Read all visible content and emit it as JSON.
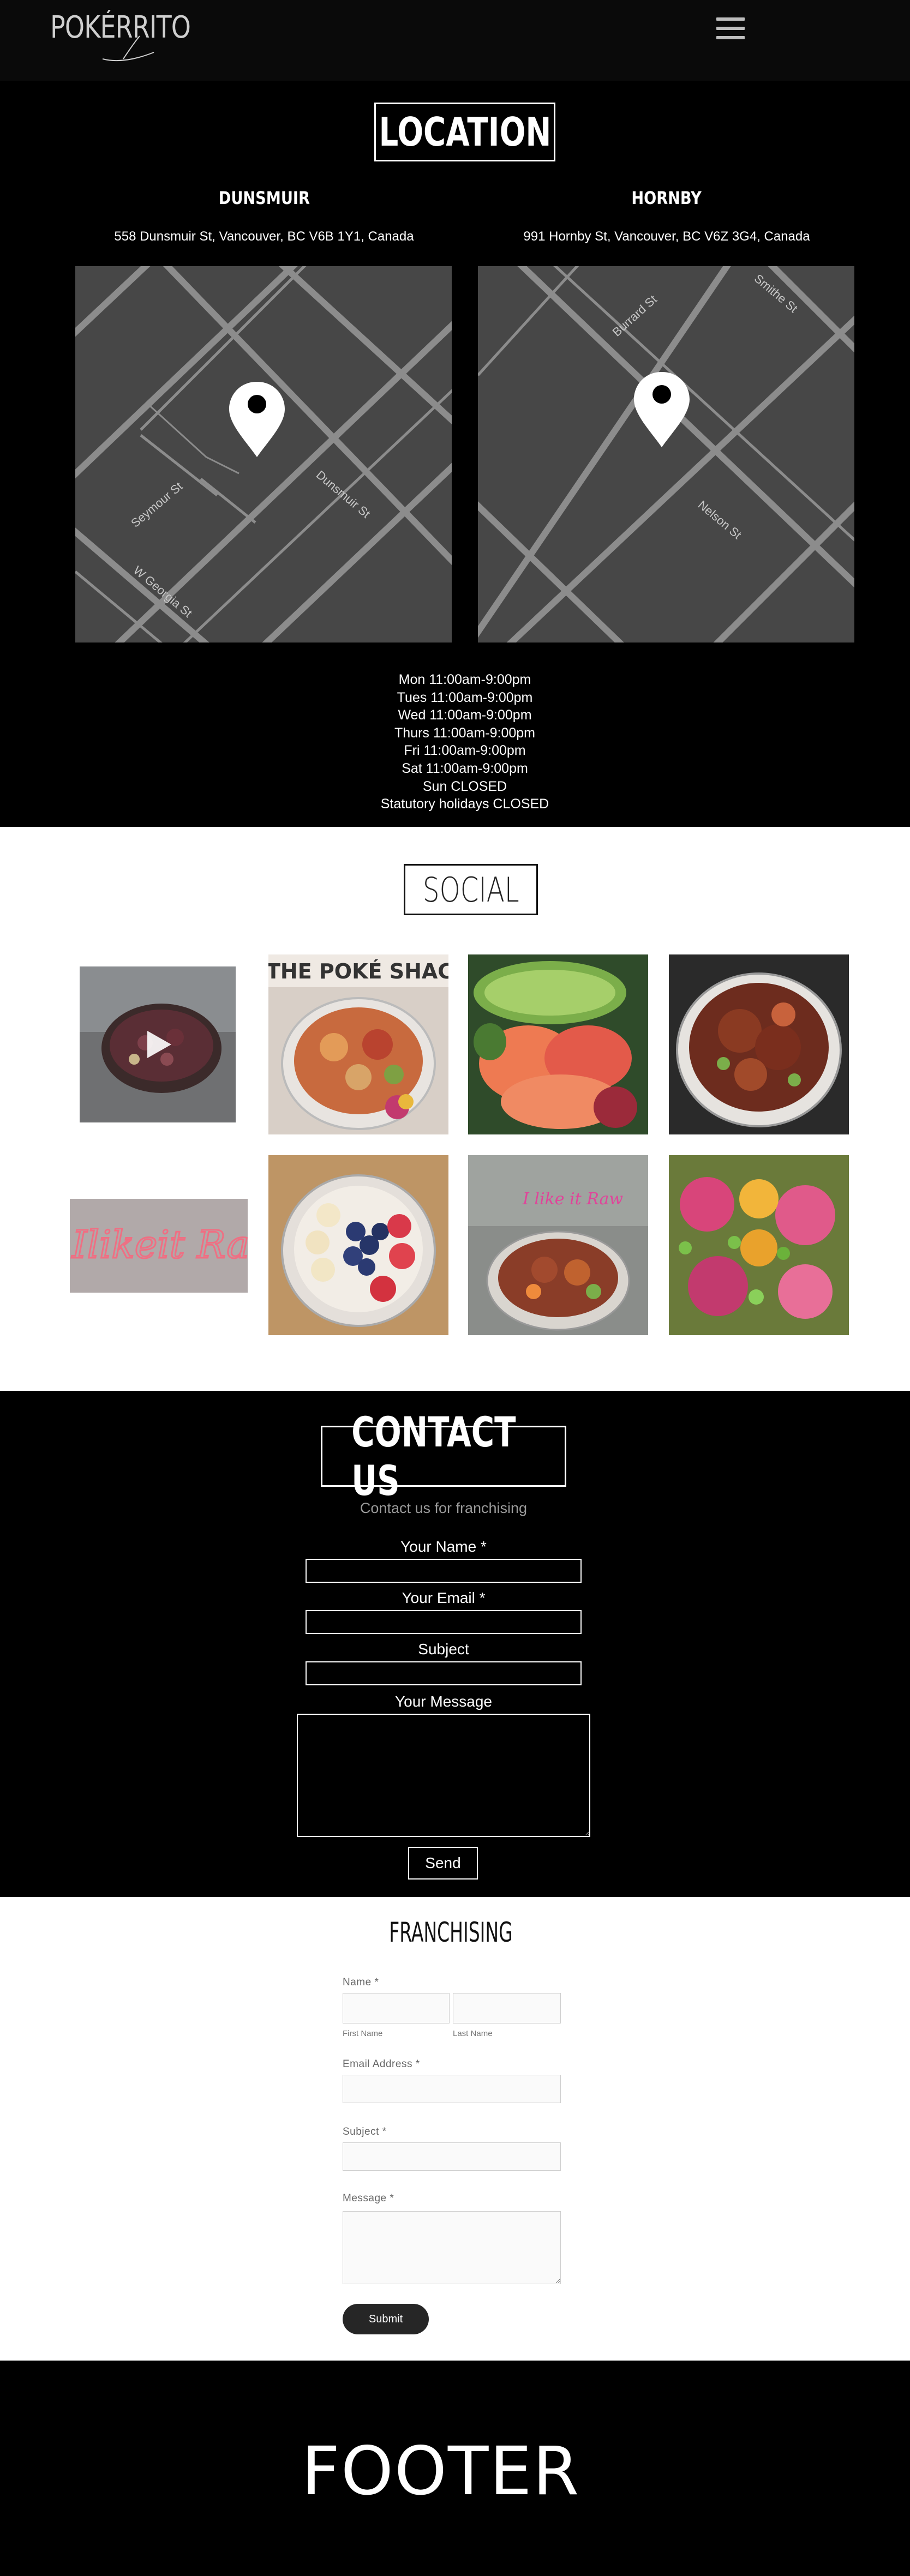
{
  "nav": {
    "logo": "POKÉRRITO",
    "menu_icon": "hamburger-icon"
  },
  "location": {
    "title": "LOCATION",
    "stores": [
      {
        "name": "DUNSMUIR",
        "address": "558 Dunsmuir St, Vancouver, BC V6B 1Y1, Canada",
        "streets": [
          "Seymour St",
          "Dunsmuir St",
          "W Georgia St"
        ]
      },
      {
        "name": "HORNBY",
        "address": "991 Hornby St, Vancouver, BC V6Z 3G4, Canada",
        "streets": [
          "Burrard St",
          "Smithe St",
          "Nelson St"
        ]
      }
    ],
    "hours": [
      "Mon 11:00am-9:00pm",
      "Tues 11:00am-9:00pm",
      "Wed 11:00am-9:00pm",
      "Thurs 11:00am-9:00pm",
      "Fri 11:00am-9:00pm",
      "Sat 11:00am-9:00pm",
      "Sun CLOSED",
      "Statutory holidays CLOSED"
    ]
  },
  "social": {
    "title": "SOCIAL",
    "banner_text": "THE POKÉ SHACK",
    "neon_text": "Ilikeit Raw",
    "sign_text": "I like it Raw"
  },
  "contact": {
    "title": "CONTACT US",
    "subtitle": "Contact us for franchising",
    "name_label": "Your Name *",
    "email_label": "Your Email *",
    "subject_label": "Subject",
    "message_label": "Your Message",
    "send_label": "Send"
  },
  "franchising": {
    "title": "FRANCHISING",
    "name_label": "Name *",
    "first_name_label": "First Name",
    "last_name_label": "Last Name",
    "email_label": "Email Address *",
    "subject_label": "Subject *",
    "message_label": "Message *",
    "submit_label": "Submit"
  },
  "footer": {
    "text": "FOOTER"
  },
  "colors": {
    "background": "#000000",
    "map_bg": "#474747",
    "map_road": "#8c8c8c",
    "submit_btn": "#262626"
  }
}
